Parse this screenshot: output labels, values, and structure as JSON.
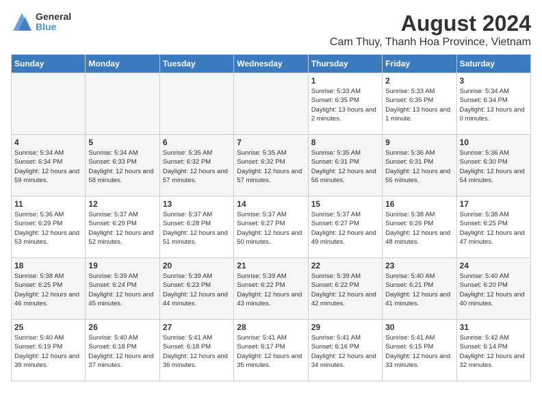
{
  "header": {
    "logo_general": "General",
    "logo_blue": "Blue",
    "title": "August 2024",
    "subtitle": "Cam Thuy, Thanh Hoa Province, Vietnam"
  },
  "days_of_week": [
    "Sunday",
    "Monday",
    "Tuesday",
    "Wednesday",
    "Thursday",
    "Friday",
    "Saturday"
  ],
  "weeks": [
    [
      {
        "day": "",
        "info": ""
      },
      {
        "day": "",
        "info": ""
      },
      {
        "day": "",
        "info": ""
      },
      {
        "day": "",
        "info": ""
      },
      {
        "day": "1",
        "info": "Sunrise: 5:33 AM\nSunset: 6:35 PM\nDaylight: 13 hours\nand 2 minutes."
      },
      {
        "day": "2",
        "info": "Sunrise: 5:33 AM\nSunset: 6:35 PM\nDaylight: 13 hours\nand 1 minute."
      },
      {
        "day": "3",
        "info": "Sunrise: 5:34 AM\nSunset: 6:34 PM\nDaylight: 13 hours\nand 0 minutes."
      }
    ],
    [
      {
        "day": "4",
        "info": "Sunrise: 5:34 AM\nSunset: 6:34 PM\nDaylight: 12 hours\nand 59 minutes."
      },
      {
        "day": "5",
        "info": "Sunrise: 5:34 AM\nSunset: 6:33 PM\nDaylight: 12 hours\nand 58 minutes."
      },
      {
        "day": "6",
        "info": "Sunrise: 5:35 AM\nSunset: 6:32 PM\nDaylight: 12 hours\nand 57 minutes."
      },
      {
        "day": "7",
        "info": "Sunrise: 5:35 AM\nSunset: 6:32 PM\nDaylight: 12 hours\nand 57 minutes."
      },
      {
        "day": "8",
        "info": "Sunrise: 5:35 AM\nSunset: 6:31 PM\nDaylight: 12 hours\nand 56 minutes."
      },
      {
        "day": "9",
        "info": "Sunrise: 5:36 AM\nSunset: 6:31 PM\nDaylight: 12 hours\nand 55 minutes."
      },
      {
        "day": "10",
        "info": "Sunrise: 5:36 AM\nSunset: 6:30 PM\nDaylight: 12 hours\nand 54 minutes."
      }
    ],
    [
      {
        "day": "11",
        "info": "Sunrise: 5:36 AM\nSunset: 6:29 PM\nDaylight: 12 hours\nand 53 minutes."
      },
      {
        "day": "12",
        "info": "Sunrise: 5:37 AM\nSunset: 6:29 PM\nDaylight: 12 hours\nand 52 minutes."
      },
      {
        "day": "13",
        "info": "Sunrise: 5:37 AM\nSunset: 6:28 PM\nDaylight: 12 hours\nand 51 minutes."
      },
      {
        "day": "14",
        "info": "Sunrise: 5:37 AM\nSunset: 6:27 PM\nDaylight: 12 hours\nand 50 minutes."
      },
      {
        "day": "15",
        "info": "Sunrise: 5:37 AM\nSunset: 6:27 PM\nDaylight: 12 hours\nand 49 minutes."
      },
      {
        "day": "16",
        "info": "Sunrise: 5:38 AM\nSunset: 6:26 PM\nDaylight: 12 hours\nand 48 minutes."
      },
      {
        "day": "17",
        "info": "Sunrise: 5:38 AM\nSunset: 6:25 PM\nDaylight: 12 hours\nand 47 minutes."
      }
    ],
    [
      {
        "day": "18",
        "info": "Sunrise: 5:38 AM\nSunset: 6:25 PM\nDaylight: 12 hours\nand 46 minutes."
      },
      {
        "day": "19",
        "info": "Sunrise: 5:39 AM\nSunset: 6:24 PM\nDaylight: 12 hours\nand 45 minutes."
      },
      {
        "day": "20",
        "info": "Sunrise: 5:39 AM\nSunset: 6:23 PM\nDaylight: 12 hours\nand 44 minutes."
      },
      {
        "day": "21",
        "info": "Sunrise: 5:39 AM\nSunset: 6:22 PM\nDaylight: 12 hours\nand 43 minutes."
      },
      {
        "day": "22",
        "info": "Sunrise: 5:39 AM\nSunset: 6:22 PM\nDaylight: 12 hours\nand 42 minutes."
      },
      {
        "day": "23",
        "info": "Sunrise: 5:40 AM\nSunset: 6:21 PM\nDaylight: 12 hours\nand 41 minutes."
      },
      {
        "day": "24",
        "info": "Sunrise: 5:40 AM\nSunset: 6:20 PM\nDaylight: 12 hours\nand 40 minutes."
      }
    ],
    [
      {
        "day": "25",
        "info": "Sunrise: 5:40 AM\nSunset: 6:19 PM\nDaylight: 12 hours\nand 39 minutes."
      },
      {
        "day": "26",
        "info": "Sunrise: 5:40 AM\nSunset: 6:18 PM\nDaylight: 12 hours\nand 37 minutes."
      },
      {
        "day": "27",
        "info": "Sunrise: 5:41 AM\nSunset: 6:18 PM\nDaylight: 12 hours\nand 36 minutes."
      },
      {
        "day": "28",
        "info": "Sunrise: 5:41 AM\nSunset: 6:17 PM\nDaylight: 12 hours\nand 35 minutes."
      },
      {
        "day": "29",
        "info": "Sunrise: 5:41 AM\nSunset: 6:16 PM\nDaylight: 12 hours\nand 34 minutes."
      },
      {
        "day": "30",
        "info": "Sunrise: 5:41 AM\nSunset: 6:15 PM\nDaylight: 12 hours\nand 33 minutes."
      },
      {
        "day": "31",
        "info": "Sunrise: 5:42 AM\nSunset: 6:14 PM\nDaylight: 12 hours\nand 32 minutes."
      }
    ]
  ]
}
